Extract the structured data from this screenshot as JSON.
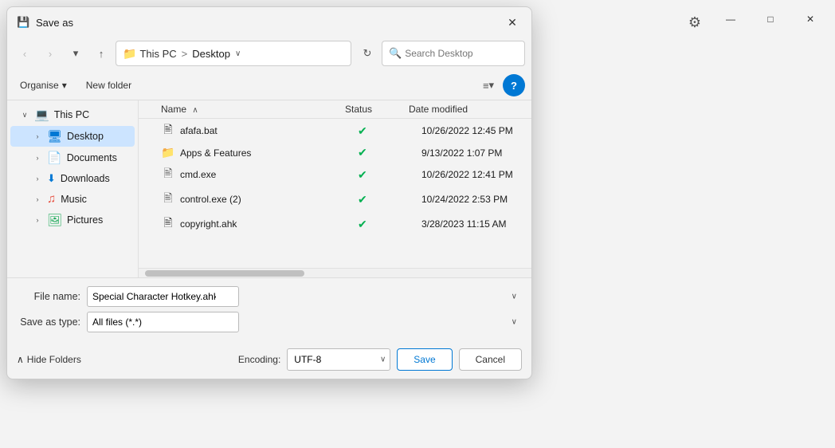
{
  "background": {
    "title": "",
    "window_controls": {
      "minimize": "—",
      "maximize": "□",
      "close": "✕"
    },
    "settings_icon": "⚙"
  },
  "dialog": {
    "title": "Save as",
    "title_icon": "💾",
    "close_btn": "✕",
    "nav": {
      "back_btn": "‹",
      "forward_btn": "›",
      "up_btn": "↑",
      "address": {
        "folder_icon": "📁",
        "crumb1": "This PC",
        "separator": ">",
        "crumb2": "Desktop",
        "chevron": "∨"
      },
      "refresh_btn": "↻",
      "search_placeholder": "Search Desktop",
      "search_icon": "🔍"
    },
    "toolbar": {
      "organise_label": "Organise",
      "organise_chevron": "▾",
      "new_folder_label": "New folder",
      "view_icon": "≡",
      "view_chevron": "▾",
      "help_label": "?"
    },
    "file_list": {
      "columns": {
        "name": "Name",
        "status": "Status",
        "date": "Date modified",
        "sort_indicator": "∧"
      },
      "files": [
        {
          "name": "afafa.bat",
          "icon": "🖹",
          "icon_type": "bat",
          "status": "✔",
          "date": "10/26/2022 12:45 PM"
        },
        {
          "name": "Apps & Features",
          "icon": "📁",
          "icon_type": "folder",
          "status": "✔",
          "date": "9/13/2022 1:07 PM"
        },
        {
          "name": "cmd.exe",
          "icon": "🖹",
          "icon_type": "exe",
          "status": "✔",
          "date": "10/26/2022 12:41 PM"
        },
        {
          "name": "control.exe (2)",
          "icon": "🖹",
          "icon_type": "exe",
          "status": "✔",
          "date": "10/24/2022 2:53 PM"
        },
        {
          "name": "copyright.ahk",
          "icon": "🖹",
          "icon_type": "ahk",
          "status": "✔",
          "date": "3/28/2023 11:15 AM"
        }
      ]
    },
    "sidebar": {
      "items": [
        {
          "label": "This PC",
          "icon": "💻",
          "icon_type": "pc",
          "expand": "∨",
          "level": 0,
          "active": false
        },
        {
          "label": "Desktop",
          "icon": "🖥",
          "icon_type": "desktop",
          "expand": "›",
          "level": 1,
          "active": true
        },
        {
          "label": "Documents",
          "icon": "📄",
          "icon_type": "docs",
          "expand": "›",
          "level": 1,
          "active": false
        },
        {
          "label": "Downloads",
          "icon": "⬇",
          "icon_type": "downloads",
          "expand": "›",
          "level": 1,
          "active": false
        },
        {
          "label": "Music",
          "icon": "♫",
          "icon_type": "music",
          "expand": "›",
          "level": 1,
          "active": false
        },
        {
          "label": "Pictures",
          "icon": "🖼",
          "icon_type": "pictures",
          "expand": "›",
          "level": 1,
          "active": false
        }
      ]
    },
    "form": {
      "filename_label": "File name:",
      "filename_value": "Special Character Hotkey.ahk",
      "savetype_label": "Save as type:",
      "savetype_value": "All files (*.*)",
      "filename_chevron": "∨",
      "savetype_chevron": "∨"
    },
    "footer": {
      "hide_folders_label": "Hide Folders",
      "hide_icon": "∧",
      "encoding_label": "Encoding:",
      "encoding_value": "UTF-8",
      "encoding_chevron": "∨",
      "save_btn": "Save",
      "cancel_btn": "Cancel"
    }
  }
}
